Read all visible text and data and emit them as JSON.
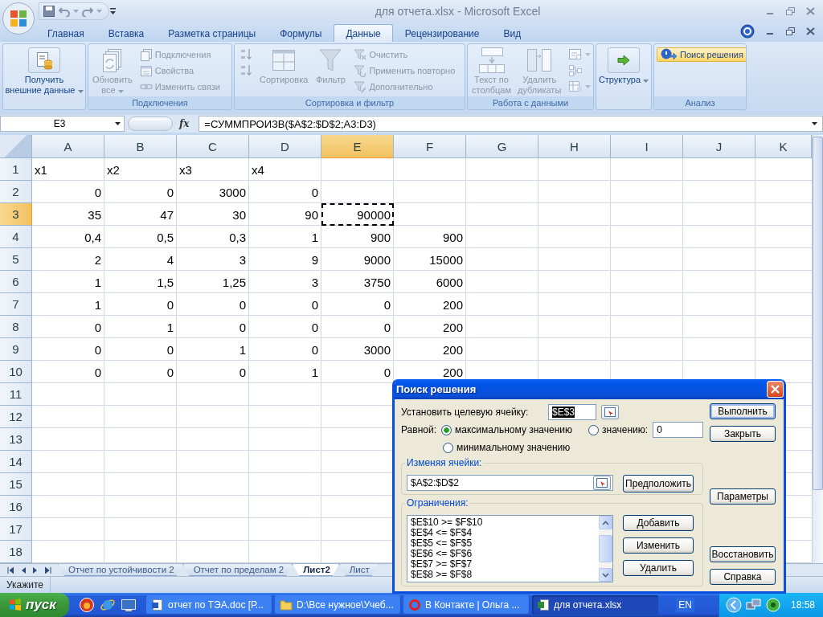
{
  "window": {
    "title": "для отчета.xlsx - Microsoft Excel"
  },
  "ribbon_tabs": [
    {
      "label": "Главная",
      "selected": false
    },
    {
      "label": "Вставка",
      "selected": false
    },
    {
      "label": "Разметка страницы",
      "selected": false
    },
    {
      "label": "Формулы",
      "selected": false
    },
    {
      "label": "Данные",
      "selected": true
    },
    {
      "label": "Рецензирование",
      "selected": false
    },
    {
      "label": "Вид",
      "selected": false
    }
  ],
  "ribbon_groups": [
    {
      "columns": [
        {
          "kind": "large",
          "label": "Получить\nвнешние данные",
          "dropdown": true,
          "disabled": false
        }
      ]
    },
    {
      "label": "Подключения",
      "columns": [
        {
          "kind": "large",
          "label": "Обновить\nвсе",
          "dropdown": true,
          "disabled": true
        },
        {
          "kind": "stack",
          "items": [
            {
              "label": "Подключения",
              "disabled": true,
              "highlighted": false
            },
            {
              "label": "Свойства",
              "disabled": true,
              "highlighted": false
            },
            {
              "label": "Изменить связи",
              "disabled": true,
              "highlighted": false
            }
          ]
        }
      ]
    },
    {
      "label": "Сортировка и фильтр",
      "columns": [
        {
          "kind": "stack",
          "items": [
            {
              "disabled": true,
              "highlighted": false
            },
            {
              "disabled": true,
              "highlighted": false
            }
          ]
        },
        {
          "kind": "large",
          "label": "Сортировка",
          "disabled": true
        },
        {
          "kind": "large",
          "label": "Фильтр",
          "disabled": true
        },
        {
          "kind": "stack",
          "items": [
            {
              "label": "Очистить",
              "disabled": true,
              "highlighted": false
            },
            {
              "label": "Применить повторно",
              "disabled": true,
              "highlighted": false
            },
            {
              "label": "Дополнительно",
              "disabled": true,
              "highlighted": false
            }
          ]
        }
      ]
    },
    {
      "label": "Работа с данными",
      "columns": [
        {
          "kind": "large",
          "label": "Текст по\nстолбцам",
          "disabled": true
        },
        {
          "kind": "large",
          "label": "Удалить\nдубликаты",
          "disabled": true
        },
        {
          "kind": "stack",
          "items": [
            {
              "disabled": true,
              "highlighted": false,
              "dropdown": true
            },
            {
              "disabled": true,
              "highlighted": false
            },
            {
              "disabled": true,
              "highlighted": false,
              "dropdown": true
            }
          ]
        }
      ]
    },
    {
      "columns": [
        {
          "kind": "large",
          "label": "Структура",
          "dropdown": true,
          "disabled": false
        }
      ]
    },
    {
      "label": "Анализ",
      "columns": [
        {
          "kind": "stack",
          "items": [
            {
              "label": "Поиск решения",
              "disabled": false,
              "highlighted": true
            }
          ]
        }
      ]
    }
  ],
  "formula_bar": {
    "name_box": "E3",
    "function_button": "fx",
    "formula": "=СУММПРОИЗВ($A$2:$D$2;A3:D3)"
  },
  "columns": [
    {
      "label": "A",
      "selected": false
    },
    {
      "label": "B",
      "selected": false
    },
    {
      "label": "C",
      "selected": false
    },
    {
      "label": "D",
      "selected": false
    },
    {
      "label": "E",
      "selected": true
    },
    {
      "label": "F",
      "selected": false
    },
    {
      "label": "G",
      "selected": false
    },
    {
      "label": "H",
      "selected": false
    },
    {
      "label": "I",
      "selected": false
    },
    {
      "label": "J",
      "selected": false
    },
    {
      "label": "K",
      "selected": false
    }
  ],
  "rows": [
    {
      "number": "1",
      "selected": false,
      "kind": "labels",
      "cells": [
        "x1",
        "x2",
        "x3",
        "x4"
      ]
    },
    {
      "number": "2",
      "selected": false,
      "kind": "values",
      "cells": [
        "0",
        "0",
        "3000",
        "0"
      ]
    },
    {
      "number": "3",
      "selected": true,
      "kind": "values",
      "cells": [
        "35",
        "47",
        "30",
        "90",
        "90000"
      ]
    },
    {
      "number": "4",
      "selected": false,
      "kind": "values",
      "cells": [
        "0,4",
        "0,5",
        "0,3",
        "1",
        "900",
        "900"
      ]
    },
    {
      "number": "5",
      "selected": false,
      "kind": "values",
      "cells": [
        "2",
        "4",
        "3",
        "9",
        "9000",
        "15000"
      ]
    },
    {
      "number": "6",
      "selected": false,
      "kind": "values",
      "cells": [
        "1",
        "1,5",
        "1,25",
        "3",
        "3750",
        "6000"
      ]
    },
    {
      "number": "7",
      "selected": false,
      "kind": "values",
      "cells": [
        "1",
        "0",
        "0",
        "0",
        "0",
        "200"
      ]
    },
    {
      "number": "8",
      "selected": false,
      "kind": "values",
      "cells": [
        "0",
        "1",
        "0",
        "0",
        "0",
        "200"
      ]
    },
    {
      "number": "9",
      "selected": false,
      "kind": "values",
      "cells": [
        "0",
        "0",
        "1",
        "0",
        "3000",
        "200"
      ]
    },
    {
      "number": "10",
      "selected": false,
      "kind": "values",
      "cells": [
        "0",
        "0",
        "0",
        "1",
        "0",
        "200"
      ]
    },
    {
      "number": "11",
      "selected": false
    },
    {
      "number": "12",
      "selected": false
    },
    {
      "number": "13",
      "selected": false
    },
    {
      "number": "14",
      "selected": false
    },
    {
      "number": "15",
      "selected": false
    },
    {
      "number": "16",
      "selected": false
    },
    {
      "number": "17",
      "selected": false
    },
    {
      "number": "18",
      "selected": false
    }
  ],
  "sheet_tabs": [
    {
      "label": "Отчет по устойчивости 2",
      "selected": false
    },
    {
      "label": "Отчет по пределам 2",
      "selected": false
    },
    {
      "label": "Лист2",
      "selected": true
    },
    {
      "label": "Лист",
      "selected": false
    }
  ],
  "status_bar": {
    "mode": "Укажите"
  },
  "dialog": {
    "title": "Поиск решения",
    "target_label": "Установить целевую ячейку:",
    "target_value": "$E$3",
    "equal_label": "Равной:",
    "options": [
      {
        "label": "максимальному значению",
        "selected": true
      },
      {
        "label": "значению:",
        "selected": false
      },
      {
        "label": "минимальному значению",
        "selected": false
      }
    ],
    "value_field": "0",
    "changing_label": "Изменяя ячейки:",
    "changing_value": "$A$2:$D$2",
    "guess_button": "Предположить",
    "constraints_label": "Ограничения:",
    "constraints": [
      "$E$10 >= $F$10",
      "$E$4 <= $F$4",
      "$E$5 <= $F$5",
      "$E$6 <= $F$6",
      "$E$7 >= $F$7",
      "$E$8 >= $F$8"
    ],
    "constraint_buttons": [
      "Добавить",
      "Изменить",
      "Удалить"
    ],
    "side_buttons": [
      {
        "label": "Выполнить",
        "default": true
      },
      {
        "label": "Закрыть",
        "default": false
      },
      {
        "label": "Параметры",
        "default": false
      },
      {
        "label": "Восстановить",
        "default": false
      },
      {
        "label": "Справка",
        "default": false
      }
    ]
  },
  "taskbar": {
    "start": "пуск",
    "tasks": [
      {
        "kind": "document",
        "label": "отчет по ТЭА.doc [Р...",
        "selected": false
      },
      {
        "kind": "folder",
        "label": "D:\\Все нужное\\Учеб...",
        "selected": false
      },
      {
        "kind": "browser",
        "label": "В Контакте | Ольга ...",
        "selected": false
      },
      {
        "kind": "spreadsheet",
        "label": "для отчета.xlsx",
        "selected": true
      }
    ],
    "language": "EN",
    "clock": "18:58"
  }
}
